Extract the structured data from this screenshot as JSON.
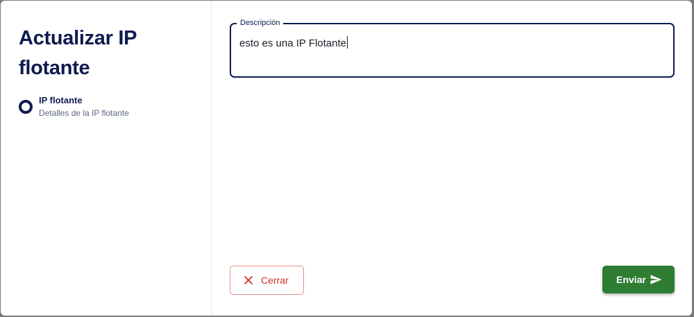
{
  "dialog": {
    "title": "Actualizar IP flotante"
  },
  "steps": [
    {
      "title": "IP flotante",
      "subtitle": "Detalles de la IP flotante"
    }
  ],
  "form": {
    "description": {
      "label": "Descripción",
      "value": "esto es una IP Flotante"
    }
  },
  "actions": {
    "close_label": "Cerrar",
    "close_icon": "close-icon",
    "submit_label": "Enviar",
    "submit_icon": "send-icon"
  },
  "colors": {
    "primary": "#0d1a4f",
    "danger": "#d32f2f",
    "success": "#2e7d32"
  }
}
